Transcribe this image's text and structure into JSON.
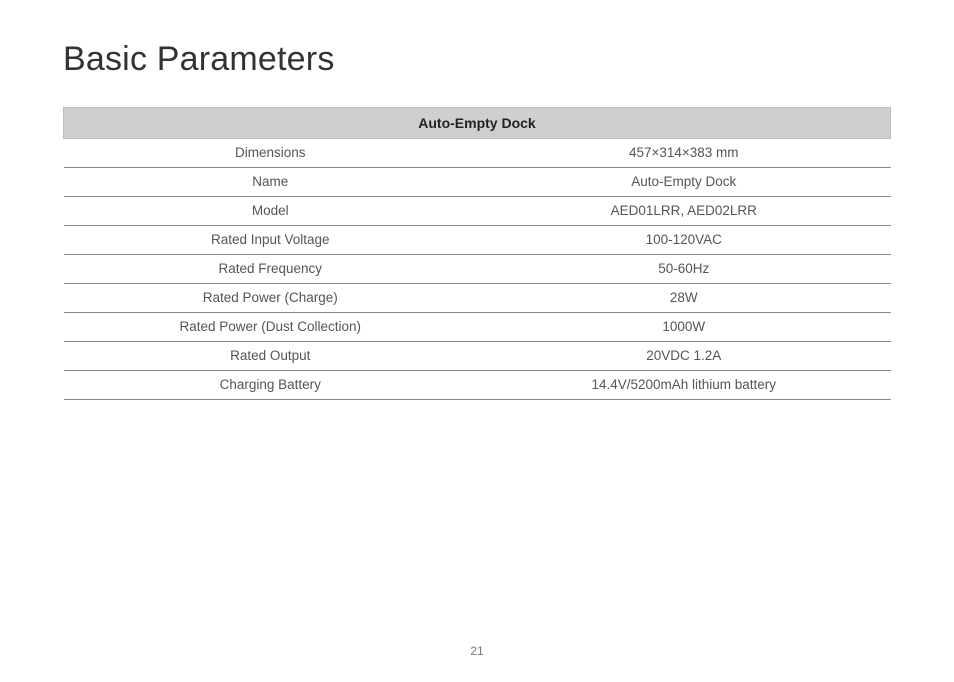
{
  "title": "Basic Parameters",
  "tableHeader": "Auto-Empty Dock",
  "rows": [
    {
      "label": "Dimensions",
      "value": "457×314×383 mm"
    },
    {
      "label": "Name",
      "value": "Auto-Empty Dock"
    },
    {
      "label": "Model",
      "value": "AED01LRR, AED02LRR"
    },
    {
      "label": "Rated Input Voltage",
      "value": "100-120VAC"
    },
    {
      "label": "Rated Frequency",
      "value": "50-60Hz"
    },
    {
      "label": "Rated Power (Charge)",
      "value": "28W"
    },
    {
      "label": "Rated Power (Dust Collection)",
      "value": "1000W"
    },
    {
      "label": "Rated Output",
      "value": "20VDC 1.2A"
    },
    {
      "label": "Charging Battery",
      "value": "14.4V/5200mAh lithium battery"
    }
  ],
  "pageNumber": "21"
}
